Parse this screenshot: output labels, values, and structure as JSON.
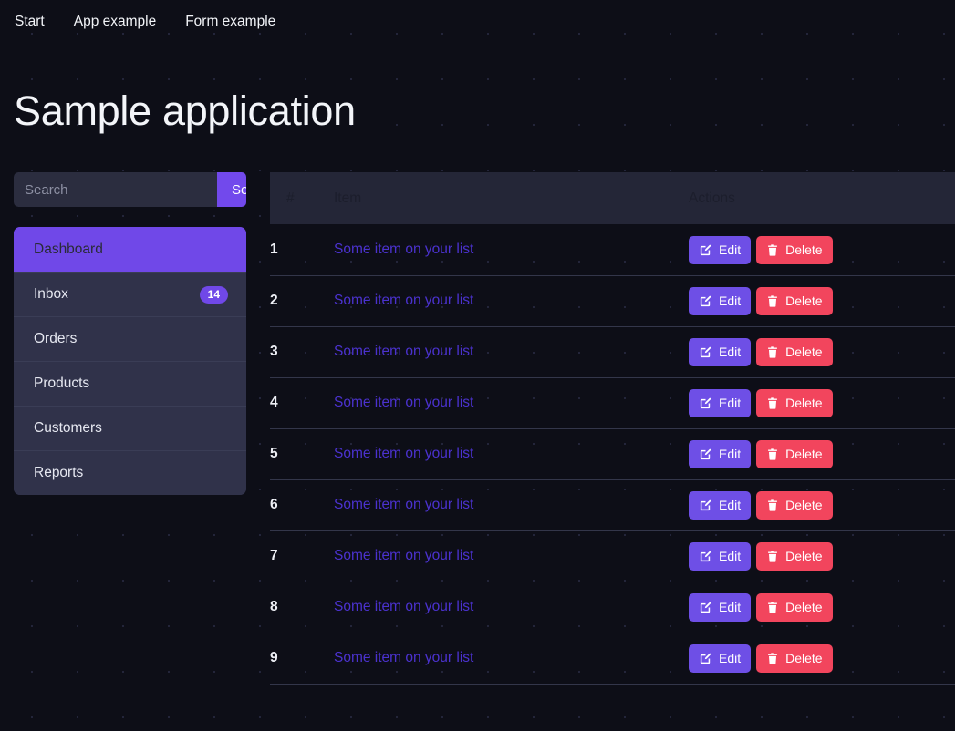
{
  "nav": {
    "links": [
      {
        "label": "Start"
      },
      {
        "label": "App example"
      },
      {
        "label": "Form example"
      }
    ]
  },
  "header": {
    "title": "Sample application"
  },
  "search": {
    "placeholder": "Search",
    "value": "",
    "button_label": "Search"
  },
  "sidebar": {
    "items": [
      {
        "label": "Dashboard",
        "active": true,
        "badge": null
      },
      {
        "label": "Inbox",
        "active": false,
        "badge": "14"
      },
      {
        "label": "Orders",
        "active": false,
        "badge": null
      },
      {
        "label": "Products",
        "active": false,
        "badge": null
      },
      {
        "label": "Customers",
        "active": false,
        "badge": null
      },
      {
        "label": "Reports",
        "active": false,
        "badge": null
      }
    ]
  },
  "table": {
    "columns": {
      "num": "#",
      "item": "Item",
      "actions": "Actions"
    },
    "actions": {
      "edit_label": "Edit",
      "delete_label": "Delete",
      "edit_icon": "pencil-square-icon",
      "delete_icon": "trash-icon"
    },
    "rows": [
      {
        "num": "1",
        "item": "Some item on your list"
      },
      {
        "num": "2",
        "item": "Some item on your list"
      },
      {
        "num": "3",
        "item": "Some item on your list"
      },
      {
        "num": "4",
        "item": "Some item on your list"
      },
      {
        "num": "5",
        "item": "Some item on your list"
      },
      {
        "num": "6",
        "item": "Some item on your list"
      },
      {
        "num": "7",
        "item": "Some item on your list"
      },
      {
        "num": "8",
        "item": "Some item on your list"
      },
      {
        "num": "9",
        "item": "Some item on your list"
      }
    ]
  },
  "colors": {
    "page_background": "#0d0e17",
    "accent_purple": "#7048e8",
    "button_edit": "#6e4fe6",
    "button_delete": "#f2455d",
    "sidebar_background": "#30324a",
    "table_header_background": "#242637",
    "link": "#4b32cf"
  }
}
